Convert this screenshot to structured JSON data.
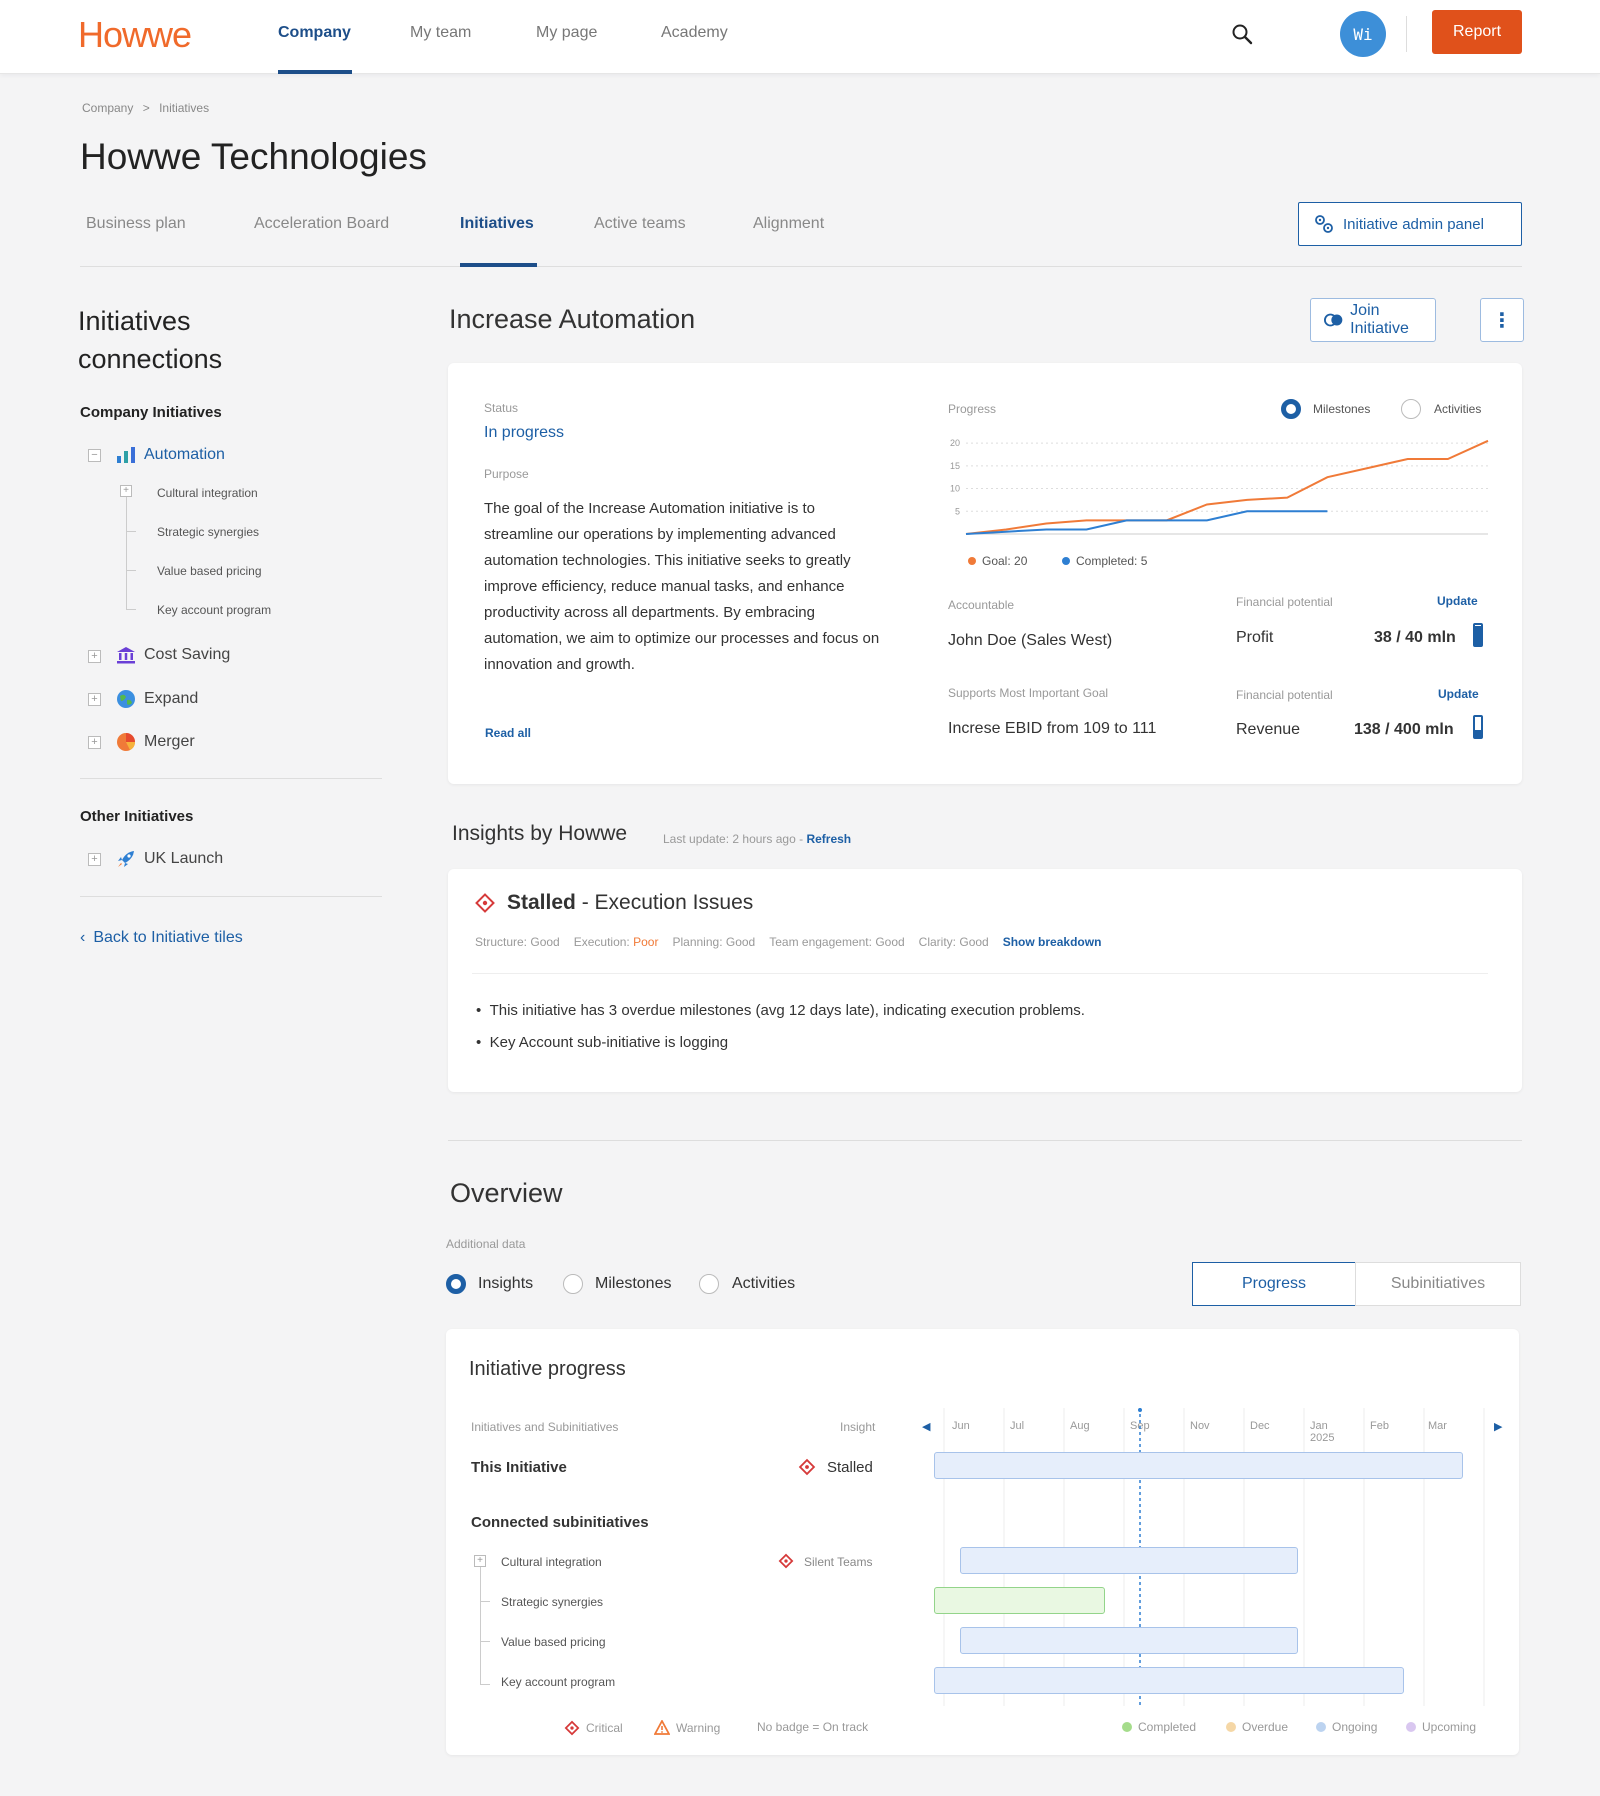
{
  "app": {
    "logo": "Howwe"
  },
  "nav": {
    "items": [
      {
        "label": "Company"
      },
      {
        "label": "My team"
      },
      {
        "label": "My page"
      },
      {
        "label": "Academy"
      }
    ],
    "avatar_initials": "Wi",
    "report_label": "Report"
  },
  "breadcrumb": {
    "root": "Company",
    "sep": ">",
    "current": "Initiatives"
  },
  "page": {
    "title": "Howwe Technologies"
  },
  "tabs": [
    {
      "label": "Business plan"
    },
    {
      "label": "Acceleration Board"
    },
    {
      "label": "Initiatives"
    },
    {
      "label": "Active teams"
    },
    {
      "label": "Alignment"
    }
  ],
  "admin_button": "Initiative admin panel",
  "sidebar": {
    "title_line1": "Initiatives",
    "title_line2": "connections",
    "company_heading": "Company Initiatives",
    "company_items": [
      {
        "label": "Automation",
        "icon": "bar-chart-icon",
        "toggle": "−",
        "children": [
          {
            "label": "Cultural integration"
          },
          {
            "label": "Strategic synergies"
          },
          {
            "label": "Value based pricing"
          },
          {
            "label": "Key account program"
          }
        ]
      },
      {
        "label": "Cost Saving",
        "icon": "bank-icon",
        "toggle": "+"
      },
      {
        "label": "Expand",
        "icon": "globe-icon",
        "toggle": "+"
      },
      {
        "label": "Merger",
        "icon": "pie-chart-icon",
        "toggle": "+"
      }
    ],
    "other_heading": "Other Initiatives",
    "other_items": [
      {
        "label": "UK Launch",
        "icon": "rocket-icon",
        "toggle": "+"
      }
    ],
    "back_link": "Back to Initiative tiles"
  },
  "initiative": {
    "title": "Increase Automation",
    "join_label": "Join Initiative",
    "more_icon": "⋮",
    "status_label": "Status",
    "status_value": "In progress",
    "purpose_label": "Purpose",
    "purpose_text": "The goal of the Increase Automation initiative is to streamline our operations by implementing advanced automation technologies. This initiative seeks to greatly improve efficiency, reduce manual tasks, and enhance productivity across all departments. By embracing automation, we aim to optimize our processes and focus on innovation and growth.",
    "read_all": "Read all",
    "progress_label": "Progress",
    "progress_radios": [
      {
        "label": "Milestones",
        "selected": true
      },
      {
        "label": "Activities",
        "selected": false
      }
    ],
    "accountable_label": "Accountable",
    "accountable_value": "John Doe (Sales West)",
    "goal_label": "Supports Most Important Goal",
    "goal_value": "Increse EBID from 109 to 111",
    "financials": [
      {
        "label": "Financial potential",
        "update": "Update",
        "name": "Profit",
        "value": "38 / 40 mln",
        "fill": 0.95
      },
      {
        "label": "Financial potential",
        "update": "Update",
        "name": "Revenue",
        "value": "138 / 400 mln",
        "fill": 0.35
      }
    ]
  },
  "chart_data": {
    "type": "line",
    "x": [
      0,
      1,
      2,
      3,
      4,
      5,
      6,
      7,
      8,
      9,
      10,
      11
    ],
    "ylim": [
      0,
      22
    ],
    "yticks": [
      5,
      10,
      15,
      20
    ],
    "series": [
      {
        "name": "Goal",
        "legend": "Goal: 20",
        "color": "#f07a38",
        "values": [
          0,
          1,
          2.3,
          3,
          3,
          3,
          6.5,
          7.5,
          8,
          12.5,
          14.5,
          16.5,
          16.5,
          20.5
        ]
      },
      {
        "name": "Completed",
        "legend": "Completed: 5",
        "color": "#2e7fd2",
        "values": [
          0,
          0.5,
          1,
          1,
          3,
          3,
          3,
          5,
          5,
          5
        ]
      }
    ],
    "grid": true
  },
  "insights": {
    "title": "Insights by Howwe",
    "last_update": "Last update: 2 hours ago -",
    "refresh": "Refresh",
    "headline_bold": "Stalled",
    "headline_rest": "- Execution Issues",
    "metrics": [
      {
        "label": "Structure:",
        "value": "Good",
        "color": "#999999"
      },
      {
        "label": "Execution:",
        "value": "Poor",
        "color": "#f07a38"
      },
      {
        "label": "Planning:",
        "value": "Good",
        "color": "#999999"
      },
      {
        "label": "Team engagement:",
        "value": "Good",
        "color": "#999999"
      },
      {
        "label": "Clarity:",
        "value": "Good",
        "color": "#999999"
      }
    ],
    "show_breakdown": "Show breakdown",
    "bullets": [
      "This initiative has 3 overdue milestones (avg 12 days late), indicating execution problems.",
      "Key Account sub-initiative is logging"
    ]
  },
  "overview": {
    "title": "Overview",
    "additional_label": "Additional data",
    "radios": [
      {
        "label": "Insights",
        "selected": true
      },
      {
        "label": "Milestones",
        "selected": false
      },
      {
        "label": "Activities",
        "selected": false
      }
    ],
    "segments": [
      {
        "label": "Progress",
        "selected": true
      },
      {
        "label": "Subinitiatives",
        "selected": false
      }
    ]
  },
  "gantt": {
    "title": "Initiative progress",
    "col_initiatives": "Initiatives and Subinitiatives",
    "col_insight": "Insight",
    "months": [
      "Jun",
      "Jul",
      "Aug",
      "Sep",
      "Nov",
      "Dec",
      "Jan 2025",
      "Feb",
      "Mar"
    ],
    "this_initiative": {
      "label": "This Initiative",
      "insight": "Stalled"
    },
    "connected_label": "Connected subinitiatives",
    "rows": [
      {
        "label": "Cultural integration",
        "insight": "Silent Teams",
        "status": "Ongoing"
      },
      {
        "label": "Strategic synergies",
        "insight": "",
        "status": "Completed"
      },
      {
        "label": "Value based pricing",
        "insight": "",
        "status": "Ongoing"
      },
      {
        "label": "Key account program",
        "insight": "",
        "status": "Ongoing"
      }
    ],
    "legend_badges": [
      {
        "label": "Critical"
      },
      {
        "label": "Warning"
      },
      {
        "label": "No badge = On track"
      }
    ],
    "legend_status": [
      {
        "label": "Completed",
        "color": "#a5dc8b"
      },
      {
        "label": "Overdue",
        "color": "#f5d7a6"
      },
      {
        "label": "Ongoing",
        "color": "#bcd3f0"
      },
      {
        "label": "Upcoming",
        "color": "#d9c7f0"
      }
    ]
  }
}
